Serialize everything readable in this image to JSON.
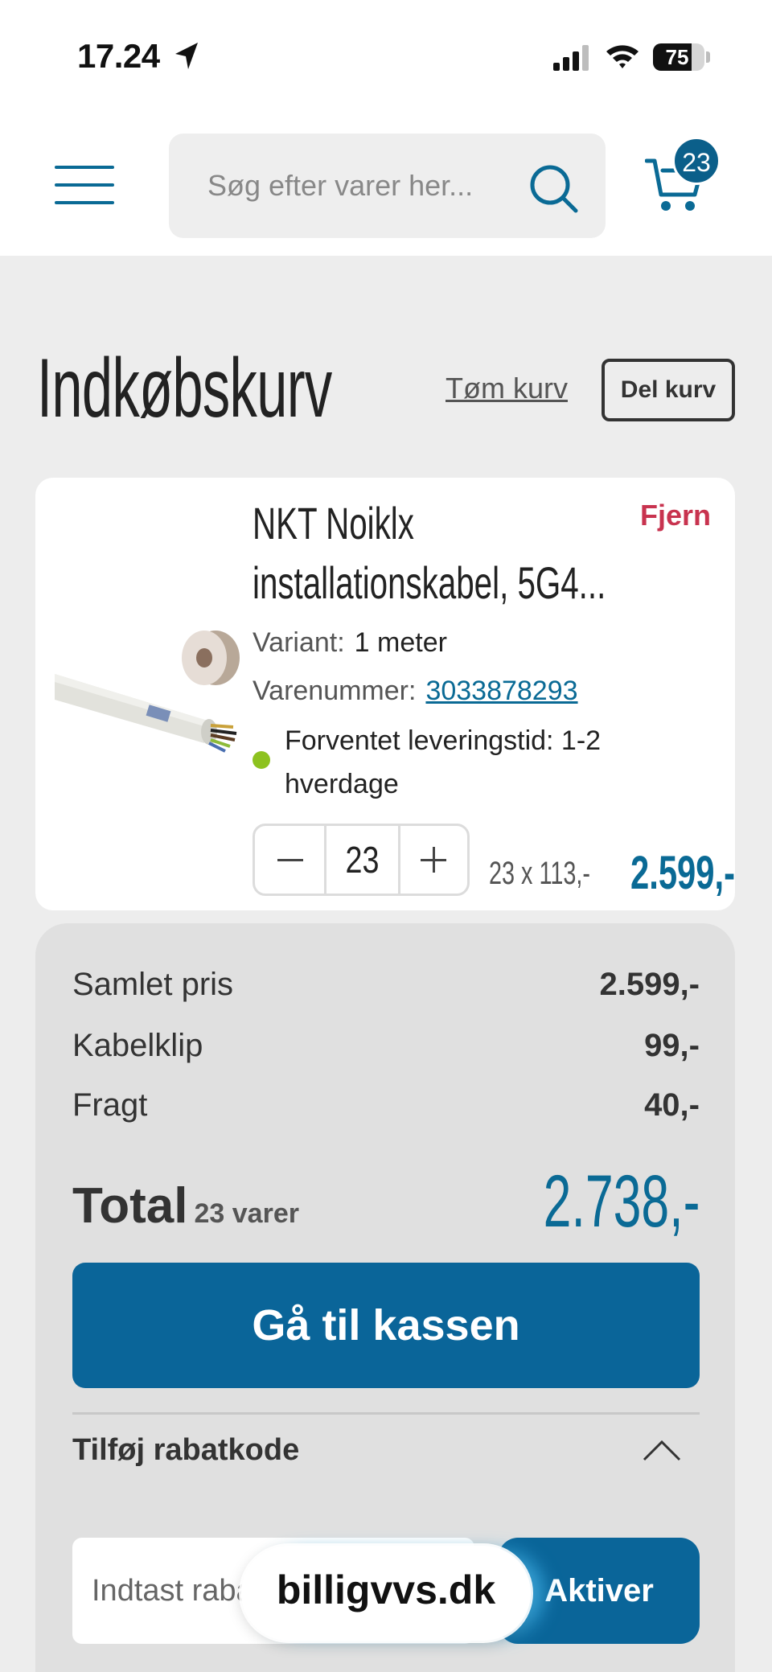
{
  "status_bar": {
    "time": "17.24",
    "battery": "75",
    "battery_level": 0.75,
    "icons": [
      "location-arrow-icon",
      "cellular-signal-icon",
      "wifi-icon",
      "battery-icon"
    ]
  },
  "header": {
    "search_placeholder": "Søg efter varer her...",
    "cart_count": "23",
    "icons": [
      "hamburger-menu-icon",
      "search-icon",
      "shopping-cart-icon"
    ]
  },
  "page": {
    "title": "Indkøbskurv",
    "empty_cart_label": "Tøm kurv",
    "share_cart_label": "Del kurv"
  },
  "cart_item": {
    "name": "NKT Noiklx installationskabel, 5G4...",
    "remove_label": "Fjern",
    "variant_label": "Variant:",
    "variant_value": "1 meter",
    "sku_label": "Varenummer:",
    "sku_value": "3033878293",
    "delivery_text": "Forventet leveringstid: 1-2 hverdage",
    "delivery_status_color": "#8dc21f",
    "quantity": "23",
    "unit_price": "23 x 113,-",
    "line_total": "2.599,-"
  },
  "summary": {
    "rows": [
      {
        "label": "Samlet pris",
        "value": "2.599,-"
      },
      {
        "label": "Kabelklip",
        "value": "99,-"
      },
      {
        "label": "Fragt",
        "value": "40,-"
      }
    ],
    "total_label": "Total",
    "total_count": "23 varer",
    "total_value": "2.738,-",
    "checkout_label": "Gå til kassen",
    "discount_title": "Tilføj rabatkode",
    "discount_placeholder": "Indtast rabatkode",
    "activate_label": "Aktiver"
  },
  "browser": {
    "domain": "billigvvs.dk"
  },
  "colors": {
    "brand_blue": "#0a6599",
    "remove_red": "#c8334f",
    "page_bg": "#ededed"
  }
}
